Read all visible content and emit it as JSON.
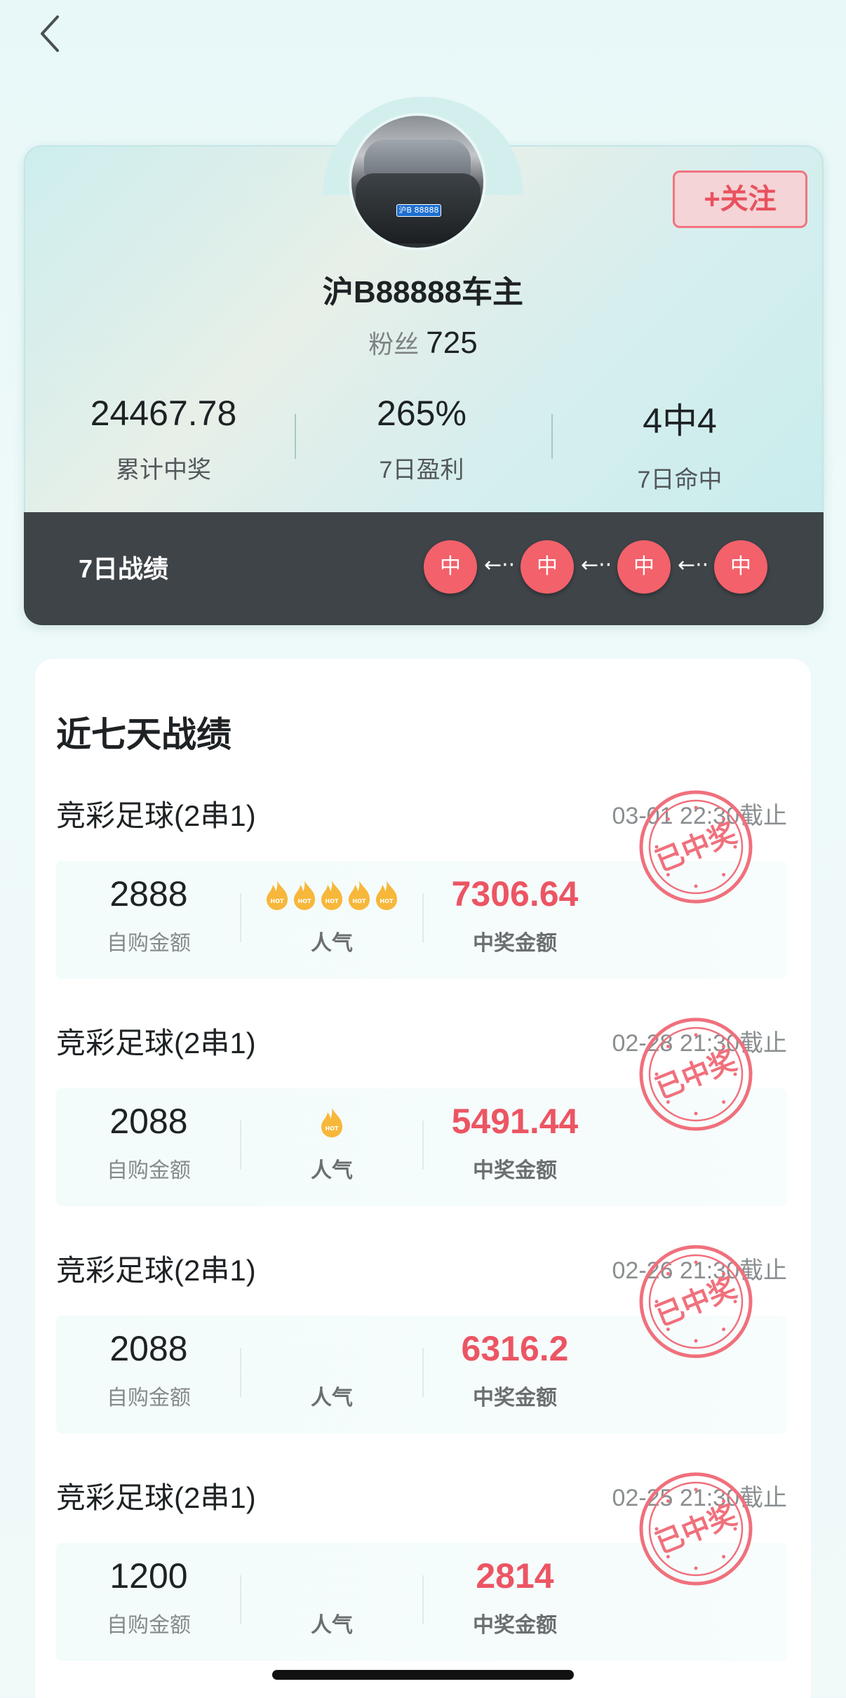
{
  "header": {
    "back_icon": "chevron-left-icon"
  },
  "profile": {
    "username": "沪B88888车主",
    "avatar_plate": "沪B 88888",
    "fans_label": "粉丝",
    "fans_count": "725",
    "follow_label": "+关注",
    "stats": [
      {
        "value": "24467.78",
        "label": "累计中奖"
      },
      {
        "value": "265%",
        "label": "7日盈利"
      },
      {
        "value": "4中4",
        "label": "7日命中"
      }
    ],
    "record_title": "7日战绩",
    "record_hits": [
      "中",
      "中",
      "中",
      "中"
    ],
    "record_arrow": "←··"
  },
  "records": {
    "title": "近七天战绩",
    "items": [
      {
        "game": "竞彩足球(2串1)",
        "deadline": "03-01 22:30截止",
        "self_amount": "2888",
        "self_label": "自购金额",
        "popularity_label": "人气",
        "flames": 5,
        "prize": "7306.64",
        "prize_label": "中奖金额",
        "stamp": "已中奖"
      },
      {
        "game": "竞彩足球(2串1)",
        "deadline": "02-28 21:30截止",
        "self_amount": "2088",
        "self_label": "自购金额",
        "popularity_label": "人气",
        "flames": 1,
        "prize": "5491.44",
        "prize_label": "中奖金额",
        "stamp": "已中奖"
      },
      {
        "game": "竞彩足球(2串1)",
        "deadline": "02-26 21:30截止",
        "self_amount": "2088",
        "self_label": "自购金额",
        "popularity_label": "人气",
        "flames": 0,
        "prize": "6316.2",
        "prize_label": "中奖金额",
        "stamp": "已中奖"
      },
      {
        "game": "竞彩足球(2串1)",
        "deadline": "02-25 21:30截止",
        "self_amount": "1200",
        "self_label": "自购金额",
        "popularity_label": "人气",
        "flames": 0,
        "prize": "2814",
        "prize_label": "中奖金额",
        "stamp": "已中奖"
      }
    ]
  },
  "flame_label": "HOT",
  "colors": {
    "accent_red": "#ec5563",
    "hit_red": "#f3616b",
    "dark_bar": "#3e4448"
  }
}
